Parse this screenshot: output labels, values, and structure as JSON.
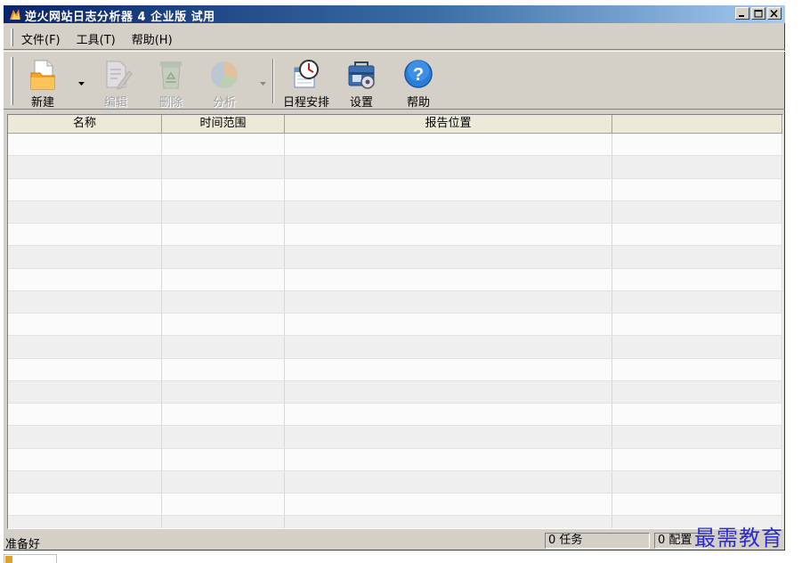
{
  "window": {
    "title": "逆火网站日志分析器 4 企业版 试用"
  },
  "menu": {
    "items": [
      {
        "label": "文件(F)"
      },
      {
        "label": "工具(T)"
      },
      {
        "label": "帮助(H)"
      }
    ]
  },
  "toolbar": {
    "buttons": [
      {
        "label": "新建",
        "icon": "new-folder-icon",
        "enabled": true
      },
      {
        "label": "编辑",
        "icon": "edit-icon",
        "enabled": false
      },
      {
        "label": "删除",
        "icon": "recycle-bin-icon",
        "enabled": false
      },
      {
        "label": "分析",
        "icon": "pie-chart-icon",
        "enabled": false
      },
      {
        "label": "日程安排",
        "icon": "clock-calendar-icon",
        "enabled": true
      },
      {
        "label": "设置",
        "icon": "toolbox-gear-icon",
        "enabled": true
      },
      {
        "label": "帮助",
        "icon": "help-icon",
        "enabled": true
      }
    ]
  },
  "table": {
    "columns": [
      "名称",
      "时间范围",
      "报告位置",
      ""
    ]
  },
  "statusbar": {
    "status": "准备好",
    "tasks": "0 任务",
    "config": "0 配置"
  },
  "watermark": {
    "text": "最需教育"
  },
  "colors": {
    "window_bg": "#d4d0c8",
    "titlebar_start": "#0a246a",
    "titlebar_end": "#a6caf0",
    "watermark": "#2b2bd0"
  }
}
